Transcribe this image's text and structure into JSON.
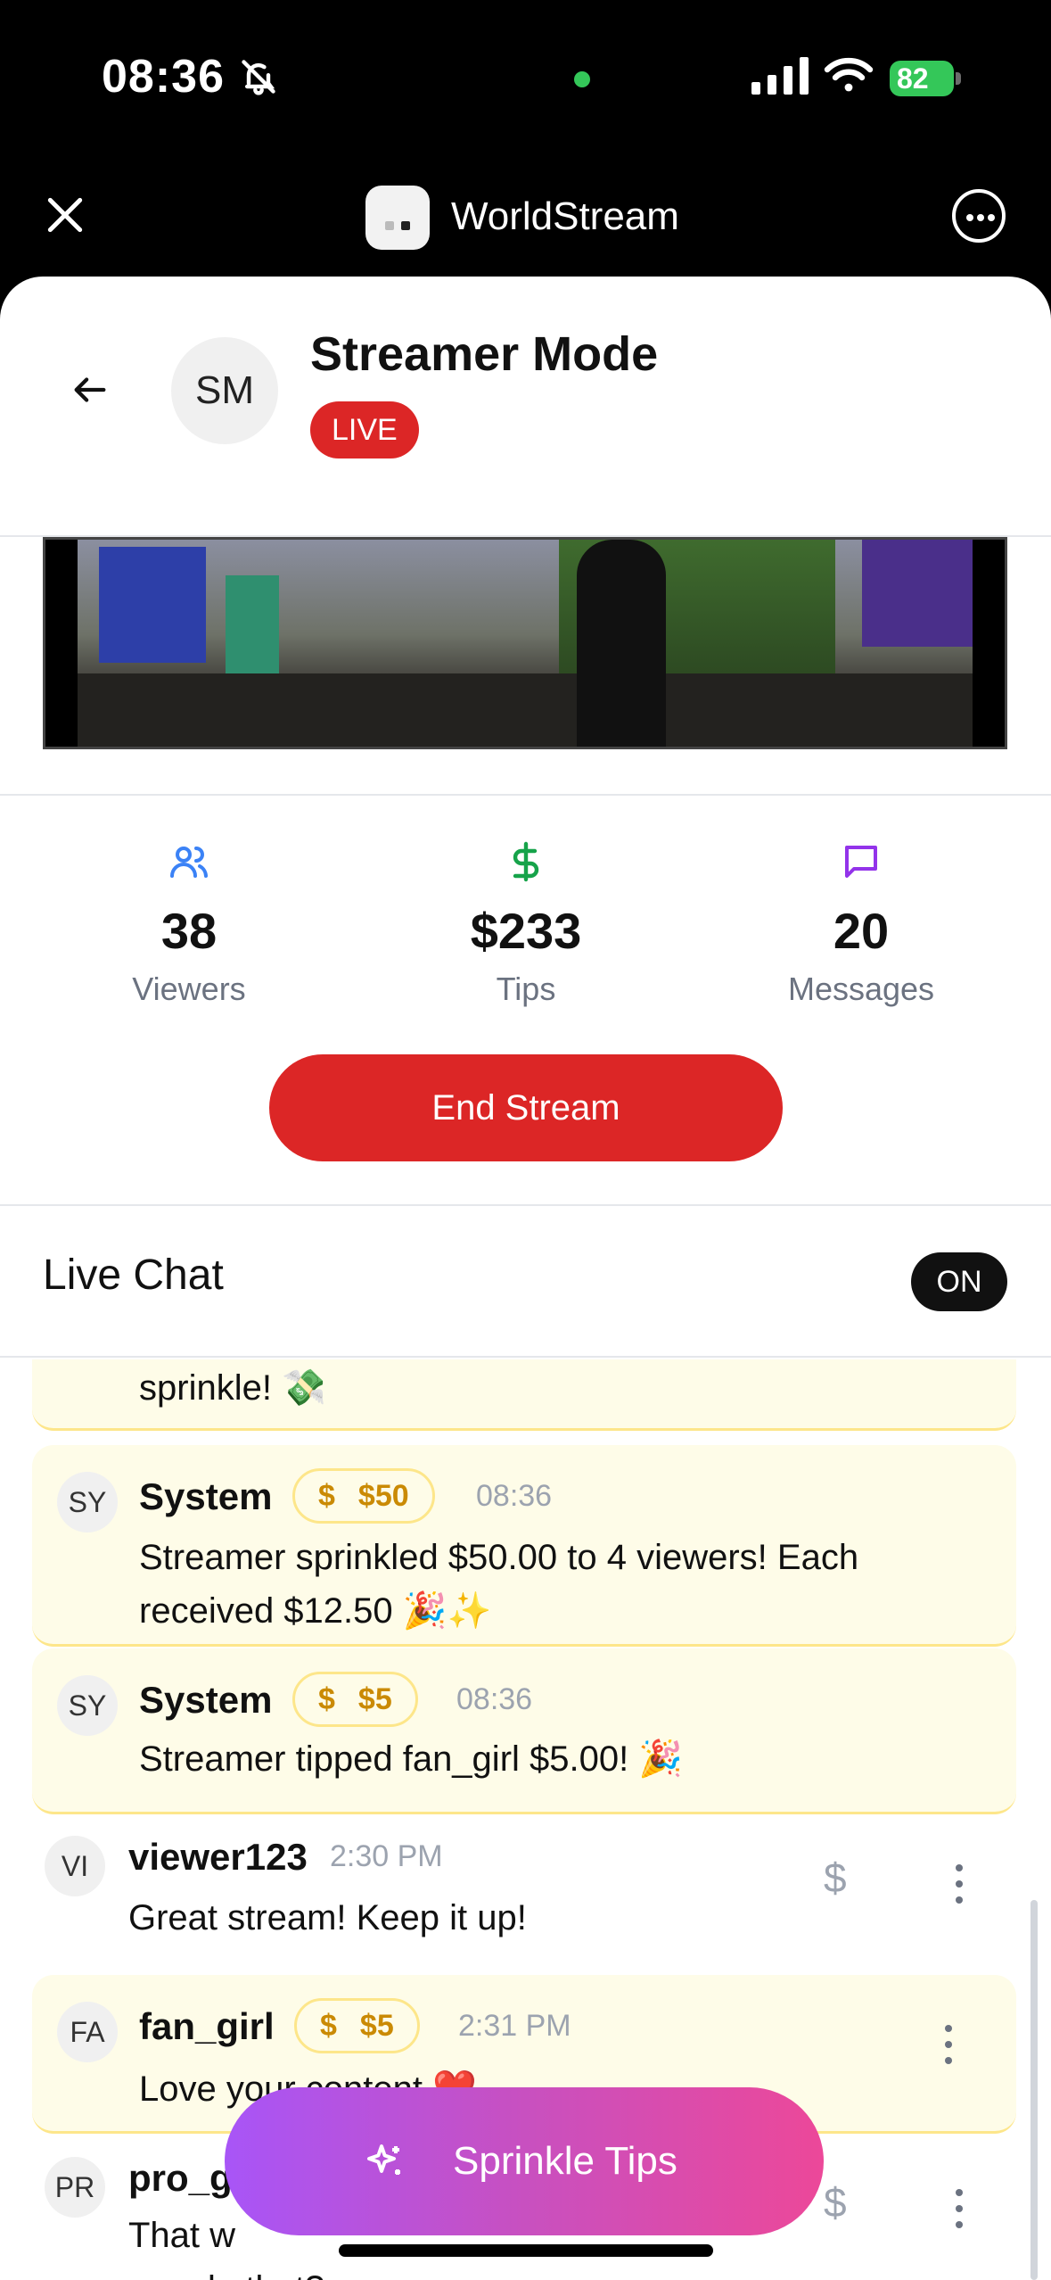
{
  "status_bar": {
    "time": "08:36",
    "battery": "82"
  },
  "app_chrome": {
    "app_name": "WorldStream"
  },
  "header": {
    "avatar_initials": "SM",
    "title": "Streamer Mode",
    "live_label": "LIVE"
  },
  "stats": {
    "viewers": {
      "value": "38",
      "label": "Viewers",
      "icon": "users-icon",
      "color": "#3b82f6"
    },
    "tips": {
      "value": "$233",
      "label": "Tips",
      "icon": "dollar-icon",
      "color": "#16a34a"
    },
    "messages": {
      "value": "20",
      "label": "Messages",
      "icon": "message-icon",
      "color": "#9333ea"
    }
  },
  "end_stream_label": "End Stream",
  "chat": {
    "title": "Live Chat",
    "toggle_label": "ON",
    "messages": [
      {
        "text": "sprinkle! 💸"
      },
      {
        "avatar": "SY",
        "user": "System",
        "tip": "$50",
        "time": "08:36",
        "text": "Streamer sprinkled $50.00 to 4 viewers! Each received $12.50 🎉✨"
      },
      {
        "avatar": "SY",
        "user": "System",
        "tip": "$5",
        "time": "08:36",
        "text": "Streamer tipped fan_girl $5.00! 🎉"
      },
      {
        "avatar": "VI",
        "user": "viewer123",
        "time": "2:30 PM",
        "text": "Great stream! Keep it up!"
      },
      {
        "avatar": "FA",
        "user": "fan_girl",
        "tip": "$5",
        "time": "2:31 PM",
        "text": "Love your content ❤️"
      },
      {
        "avatar": "PR",
        "user": "pro_g",
        "text_line1": "That w",
        "text_line2": "you do that?"
      }
    ],
    "tip_symbol": "$"
  },
  "sprinkle_label": "Sprinkle Tips",
  "colors": {
    "live_red": "#dc2626",
    "tip_gold": "#ca8a04",
    "highlight_bg": "#fefce8"
  }
}
